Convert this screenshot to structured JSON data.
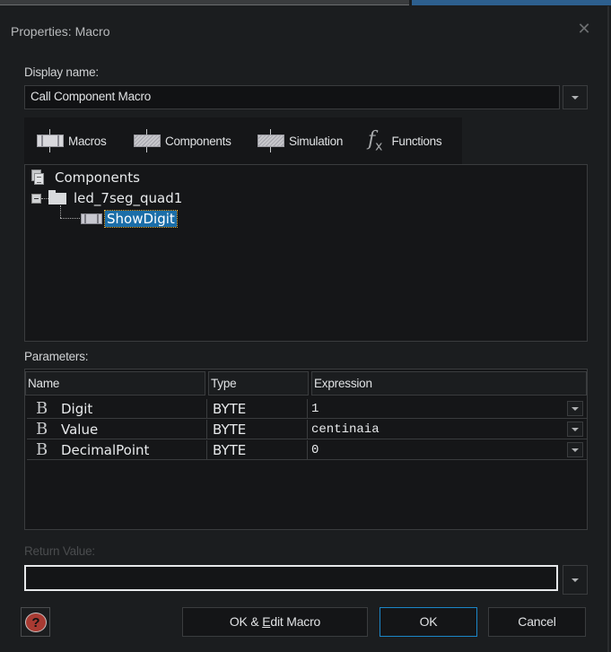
{
  "window": {
    "title": "Properties: Macro",
    "close_icon": "close-icon"
  },
  "display_name": {
    "label": "Display name:",
    "value": "Call Component Macro"
  },
  "tabs": [
    {
      "label": "Macros",
      "icon": "macro-icon"
    },
    {
      "label": "Components",
      "icon": "component-macro-icon"
    },
    {
      "label": "Simulation",
      "icon": "simulation-macro-icon"
    },
    {
      "label": "Functions",
      "icon": "fx-icon"
    }
  ],
  "tree": {
    "root": {
      "label": "Components",
      "icon": "documents-icon"
    },
    "node": {
      "label": "led_7seg_quad1",
      "icon": "folder-icon",
      "expanded": true
    },
    "child": {
      "label": "ShowDigit",
      "icon": "macro-icon",
      "selected": true
    }
  },
  "parameters": {
    "label": "Parameters:",
    "columns": [
      "Name",
      "Type",
      "Expression"
    ],
    "rows": [
      {
        "icon": "byte-icon",
        "icon_glyph": "B",
        "name": "Digit",
        "type": "BYTE",
        "expression": "1"
      },
      {
        "icon": "byte-icon",
        "icon_glyph": "B",
        "name": "Value",
        "type": "BYTE",
        "expression": "centinaia"
      },
      {
        "icon": "byte-icon",
        "icon_glyph": "B",
        "name": "DecimalPoint",
        "type": "BYTE",
        "expression": "0"
      }
    ]
  },
  "return_value": {
    "label": "Return Value:",
    "value": "",
    "enabled": false
  },
  "buttons": {
    "help_glyph": "?",
    "ok_edit_prefix": "OK & ",
    "ok_edit_mnemonic": "E",
    "ok_edit_suffix": "dit Macro",
    "ok": "OK",
    "cancel": "Cancel"
  },
  "colors": {
    "accent": "#1b86c8",
    "selection": "#1b6ea8",
    "background": "#1b1d1f",
    "help_icon": "#a83a32"
  }
}
